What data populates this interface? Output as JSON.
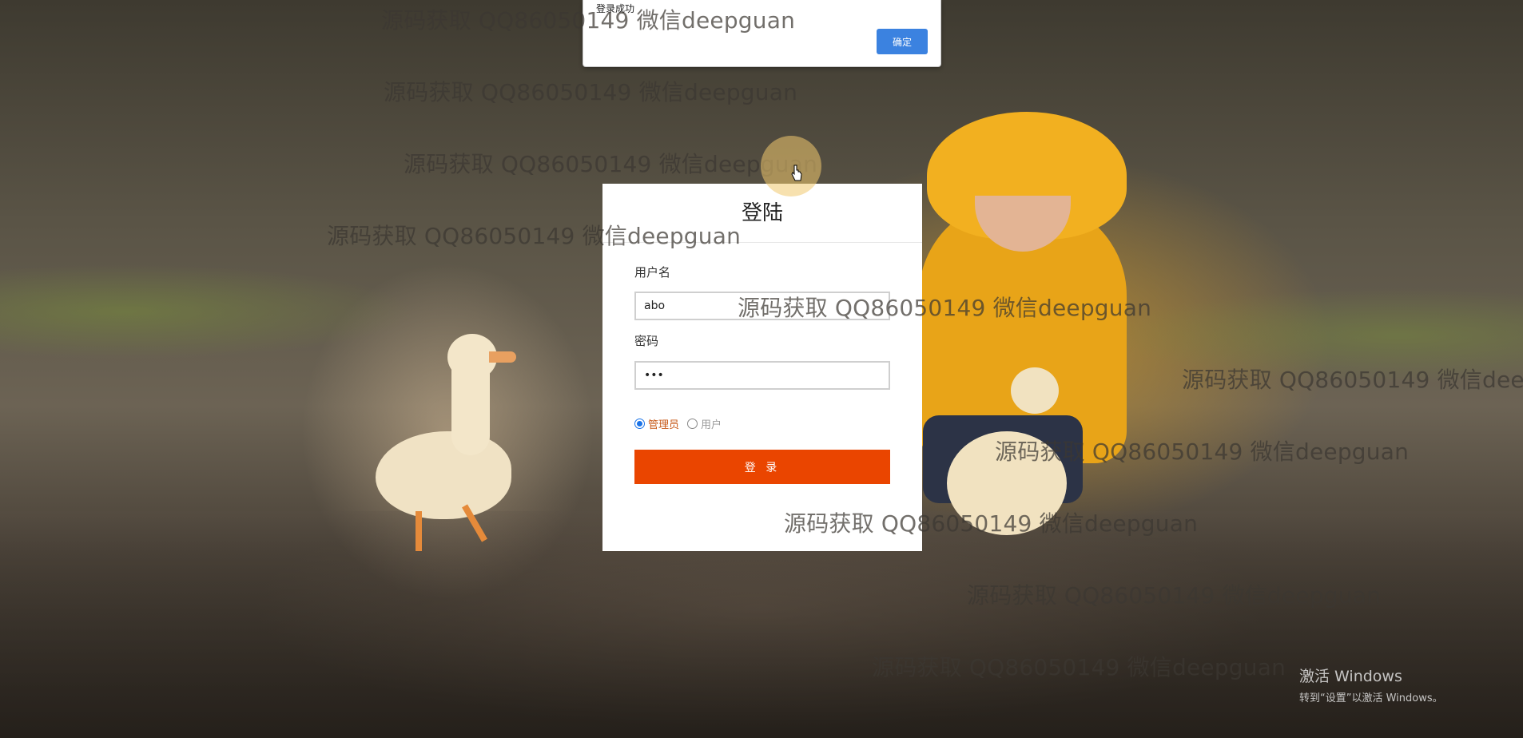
{
  "alert": {
    "message": "登录成功",
    "ok_label": "确定"
  },
  "login": {
    "title": "登陆",
    "username_label": "用户名",
    "username_value": "abo",
    "password_label": "密码",
    "password_value": "•••",
    "roles": [
      {
        "label": "管理员",
        "checked": true
      },
      {
        "label": "用户",
        "checked": false
      }
    ],
    "submit_label": "登 录",
    "accent_color": "#ea4500"
  },
  "watermark": {
    "text": "源码获取 QQ86050149 微信deepguan"
  },
  "windows_activation": {
    "title": "激活 Windows",
    "subtitle": "转到“设置”以激活 Windows。"
  }
}
